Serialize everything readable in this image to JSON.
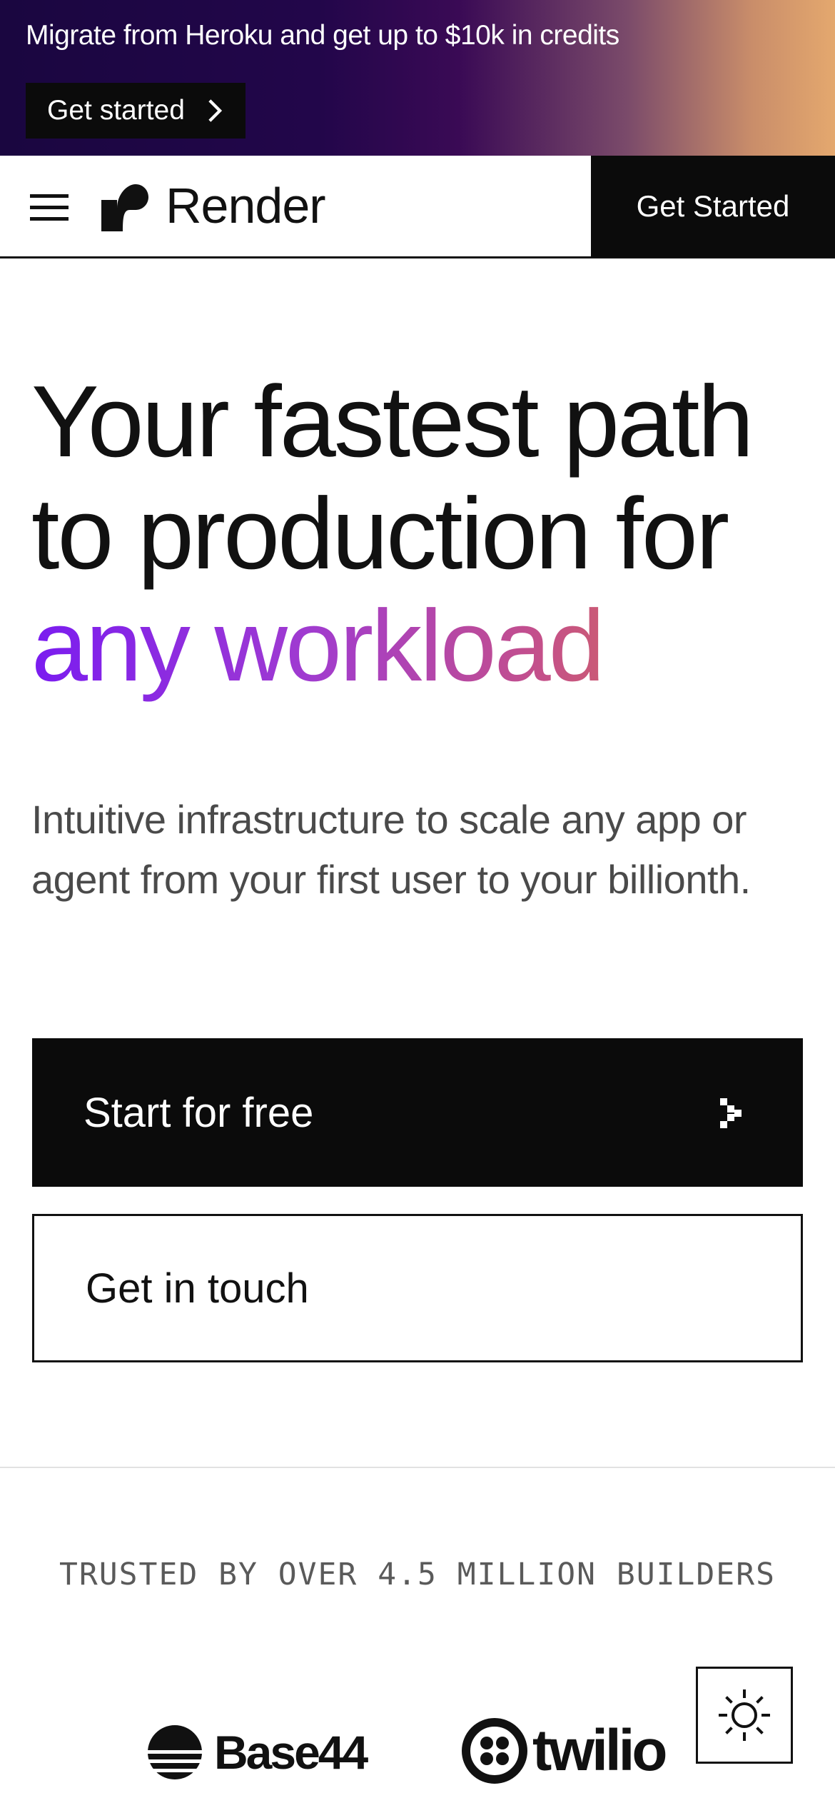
{
  "promo": {
    "text": "Migrate from Heroku and get up to $10k in credits",
    "button_label": "Get started"
  },
  "nav": {
    "logo_text": "Render",
    "cta_label": "Get Started"
  },
  "hero": {
    "title_line1": "Your fastest path",
    "title_line2": "to production for",
    "title_highlight": "any workload",
    "subtitle": "Intuitive infrastructure to scale any app or agent from your first user to your billionth.",
    "primary_button": "Start for free",
    "secondary_button": "Get in touch"
  },
  "trusted": {
    "label": "TRUSTED BY OVER 4.5 MILLION BUILDERS",
    "logos": [
      {
        "name": "Base44",
        "icon": "base44-logo"
      },
      {
        "name": "twilio",
        "icon": "twilio-logo"
      }
    ]
  },
  "theme_toggle": {
    "icon": "sun-icon"
  },
  "colors": {
    "highlight_gradient": [
      "#7a1cf0",
      "#a03bd0",
      "#c4508a",
      "#e07f2e"
    ],
    "promo_gradient": [
      "#1a0640",
      "#3a0a55",
      "#c98d6a",
      "#e4a86e"
    ],
    "primary_button": "#0b0b0b"
  }
}
